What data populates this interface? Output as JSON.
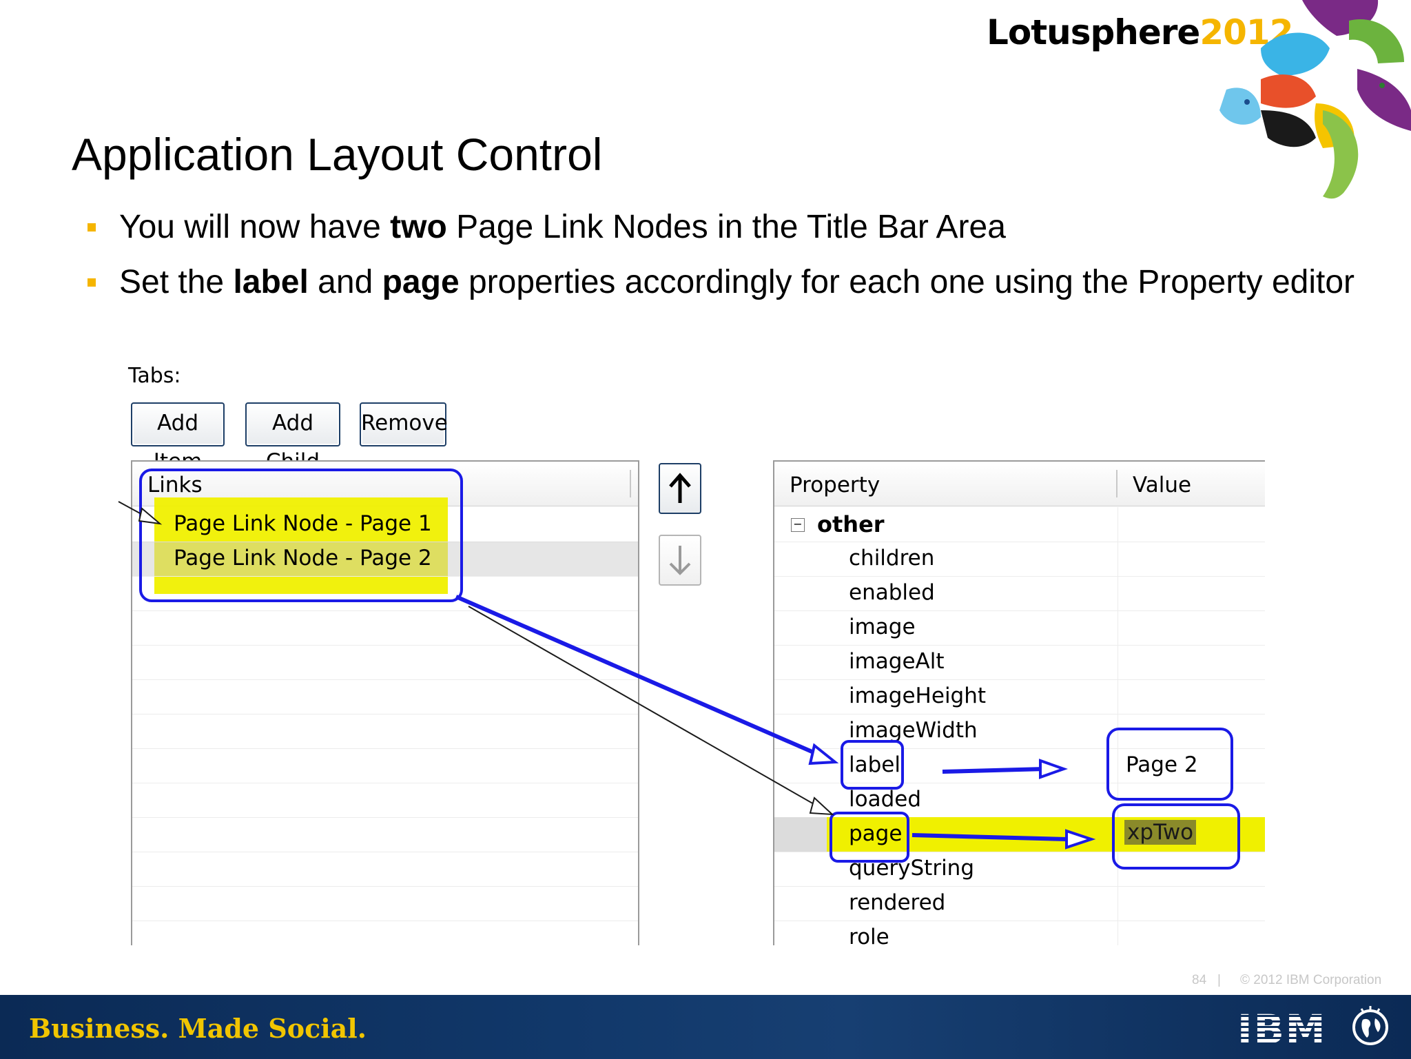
{
  "header": {
    "brand_name": "Lotusphere",
    "brand_year": "2012"
  },
  "slide": {
    "title": "Application Layout Control",
    "bullets": [
      {
        "pre": "You will now have ",
        "bold": "two",
        "post": " Page Link Nodes in the Title Bar Area"
      },
      {
        "pre": "Set the ",
        "bold1": "label",
        "mid": " and ",
        "bold2": "page",
        "post": " properties accordingly for each one using the Property editor"
      }
    ]
  },
  "editor": {
    "tabs_label": "Tabs:",
    "buttons": {
      "add_item": "Add Item",
      "add_child": "Add Child",
      "remove": "Remove"
    },
    "tree": {
      "header": "Links",
      "items": [
        "Page Link Node - Page 1",
        "Page Link Node - Page 2"
      ]
    },
    "properties": {
      "header_property": "Property",
      "header_value": "Value",
      "category": "other",
      "category_toggle": "−",
      "rows": [
        {
          "name": "children",
          "value": ""
        },
        {
          "name": "enabled",
          "value": ""
        },
        {
          "name": "image",
          "value": ""
        },
        {
          "name": "imageAlt",
          "value": ""
        },
        {
          "name": "imageHeight",
          "value": ""
        },
        {
          "name": "imageWidth",
          "value": ""
        },
        {
          "name": "label",
          "value": "Page 2"
        },
        {
          "name": "loaded",
          "value": ""
        },
        {
          "name": "page",
          "value": "xpTwo"
        },
        {
          "name": "queryString",
          "value": ""
        },
        {
          "name": "rendered",
          "value": ""
        },
        {
          "name": "role",
          "value": ""
        }
      ]
    }
  },
  "footer": {
    "slide_number": "84",
    "separator": "|",
    "copyright": "© 2012 IBM Corporation",
    "tagline": "Business. Made Social.",
    "ibm_logo": "IBM"
  },
  "colors": {
    "accent_yellow": "#f5b500",
    "highlight": "#f0f000",
    "annotation_blue": "#1a1ae6",
    "footer_navy": "#0b2a55"
  },
  "icons": [
    "arrow-up-icon",
    "arrow-down-icon",
    "collapse-minus-icon",
    "globe-icon",
    "lotusphere-logo-art"
  ]
}
